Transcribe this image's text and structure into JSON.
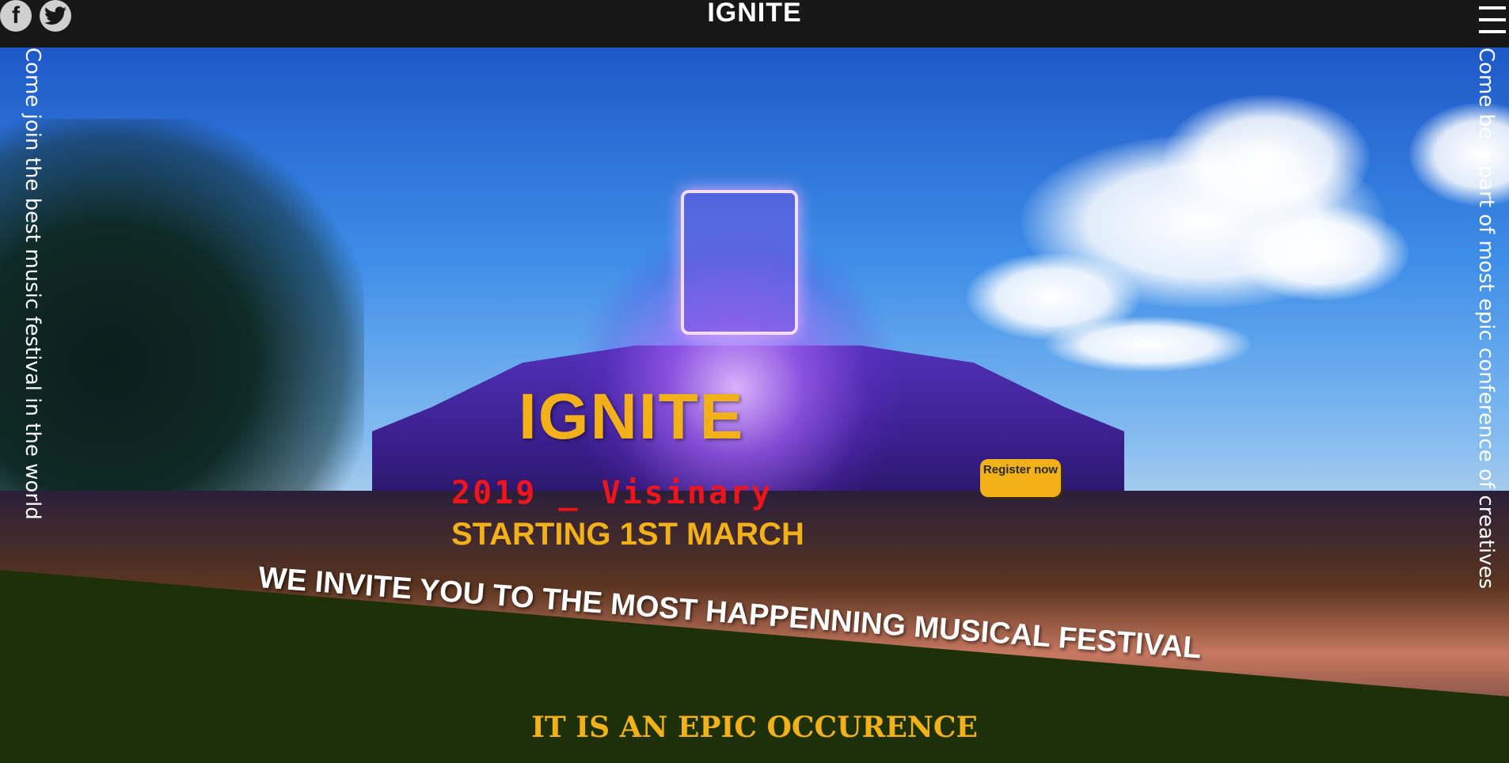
{
  "header": {
    "brand": "IGNITE",
    "social": [
      {
        "name": "facebook",
        "icon": "facebook-icon",
        "glyph": "f"
      },
      {
        "name": "twitter",
        "icon": "twitter-icon"
      }
    ],
    "menu_icon": "hamburger-menu-icon"
  },
  "side_text": {
    "left": "Come join the best music festival in the world",
    "right": "Come be a part of most epic conference of creatives"
  },
  "hero": {
    "title": "IGNITE",
    "edition": "2019 _ Visinary",
    "start": "STARTING 1ST MARCH",
    "register_label": "Register now",
    "invite": "WE INVITE YOU TO THE MOST HAPPENNING MUSICAL FESTIVAL"
  },
  "section": {
    "heading": "IT IS AN EPIC OCCURENCE"
  },
  "colors": {
    "accent": "#f2b118",
    "edition_red": "#f0151c",
    "topbar": "#171717",
    "grass": "#1e3008"
  }
}
